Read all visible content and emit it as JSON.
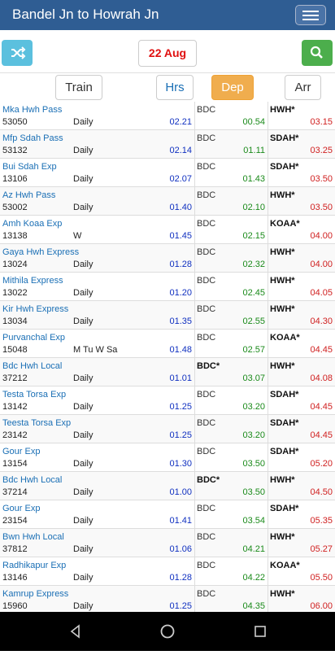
{
  "header": {
    "title": "Bandel Jn to Howrah Jn"
  },
  "toolbar": {
    "date": "22 Aug"
  },
  "columns": {
    "train": "Train",
    "hrs": "Hrs",
    "dep": "Dep",
    "arr": "Arr"
  },
  "colors": {
    "header_bg": "#2f5d93",
    "shuffle": "#5bc0de",
    "search": "#4cae4c",
    "dep_active": "#f0ad4e",
    "date": "#e01010"
  },
  "icons": {
    "menu": "hamburger-icon",
    "shuffle": "shuffle-icon",
    "search": "search-icon",
    "back": "back-icon",
    "home": "home-icon",
    "recents": "recents-icon"
  },
  "trains": [
    {
      "name": "Mka Hwh Pass",
      "number": "53050",
      "days": "Daily",
      "hrs": "02.21",
      "from": "BDC",
      "from_bold": false,
      "dep": "00.54",
      "to": "HWH*",
      "arr": "03.15"
    },
    {
      "name": "Mfp Sdah Pass",
      "number": "53132",
      "days": "Daily",
      "hrs": "02.14",
      "from": "BDC",
      "from_bold": false,
      "dep": "01.11",
      "to": "SDAH*",
      "arr": "03.25"
    },
    {
      "name": "Bui Sdah Exp",
      "number": "13106",
      "days": "Daily",
      "hrs": "02.07",
      "from": "BDC",
      "from_bold": false,
      "dep": "01.43",
      "to": "SDAH*",
      "arr": "03.50"
    },
    {
      "name": "Az Hwh Pass",
      "number": "53002",
      "days": "Daily",
      "hrs": "01.40",
      "from": "BDC",
      "from_bold": false,
      "dep": "02.10",
      "to": "HWH*",
      "arr": "03.50"
    },
    {
      "name": "Amh Koaa Exp",
      "number": "13138",
      "days": "W",
      "hrs": "01.45",
      "from": "BDC",
      "from_bold": false,
      "dep": "02.15",
      "to": "KOAA*",
      "arr": "04.00"
    },
    {
      "name": "Gaya Hwh Express",
      "number": "13024",
      "days": "Daily",
      "hrs": "01.28",
      "from": "BDC",
      "from_bold": false,
      "dep": "02.32",
      "to": "HWH*",
      "arr": "04.00"
    },
    {
      "name": "Mithila Express",
      "number": "13022",
      "days": "Daily",
      "hrs": "01.20",
      "from": "BDC",
      "from_bold": false,
      "dep": "02.45",
      "to": "HWH*",
      "arr": "04.05"
    },
    {
      "name": "Kir Hwh Express",
      "number": "13034",
      "days": "Daily",
      "hrs": "01.35",
      "from": "BDC",
      "from_bold": false,
      "dep": "02.55",
      "to": "HWH*",
      "arr": "04.30"
    },
    {
      "name": "Purvanchal Exp",
      "number": "15048",
      "days": "M Tu W Sa",
      "hrs": "01.48",
      "from": "BDC",
      "from_bold": false,
      "dep": "02.57",
      "to": "KOAA*",
      "arr": "04.45"
    },
    {
      "name": "Bdc Hwh Local",
      "number": "37212",
      "days": "Daily",
      "hrs": "01.01",
      "from": "BDC*",
      "from_bold": true,
      "dep": "03.07",
      "to": "HWH*",
      "arr": "04.08"
    },
    {
      "name": "Testa Torsa Exp",
      "number": "13142",
      "days": "Daily",
      "hrs": "01.25",
      "from": "BDC",
      "from_bold": false,
      "dep": "03.20",
      "to": "SDAH*",
      "arr": "04.45"
    },
    {
      "name": "Teesta Torsa Exp",
      "number": "23142",
      "days": "Daily",
      "hrs": "01.25",
      "from": "BDC",
      "from_bold": false,
      "dep": "03.20",
      "to": "SDAH*",
      "arr": "04.45"
    },
    {
      "name": "Gour Exp",
      "number": "13154",
      "days": "Daily",
      "hrs": "01.30",
      "from": "BDC",
      "from_bold": false,
      "dep": "03.50",
      "to": "SDAH*",
      "arr": "05.20"
    },
    {
      "name": "Bdc Hwh Local",
      "number": "37214",
      "days": "Daily",
      "hrs": "01.00",
      "from": "BDC*",
      "from_bold": true,
      "dep": "03.50",
      "to": "HWH*",
      "arr": "04.50"
    },
    {
      "name": "Gour Exp",
      "number": "23154",
      "days": "Daily",
      "hrs": "01.41",
      "from": "BDC",
      "from_bold": false,
      "dep": "03.54",
      "to": "SDAH*",
      "arr": "05.35"
    },
    {
      "name": "Bwn Hwh Local",
      "number": "37812",
      "days": "Daily",
      "hrs": "01.06",
      "from": "BDC",
      "from_bold": false,
      "dep": "04.21",
      "to": "HWH*",
      "arr": "05.27"
    },
    {
      "name": "Radhikapur Exp",
      "number": "13146",
      "days": "Daily",
      "hrs": "01.28",
      "from": "BDC",
      "from_bold": false,
      "dep": "04.22",
      "to": "KOAA*",
      "arr": "05.50"
    },
    {
      "name": "Kamrup Express",
      "number": "15960",
      "days": "Daily",
      "hrs": "01.25",
      "from": "BDC",
      "from_bold": false,
      "dep": "04.35",
      "to": "HWH*",
      "arr": "06.00"
    }
  ]
}
